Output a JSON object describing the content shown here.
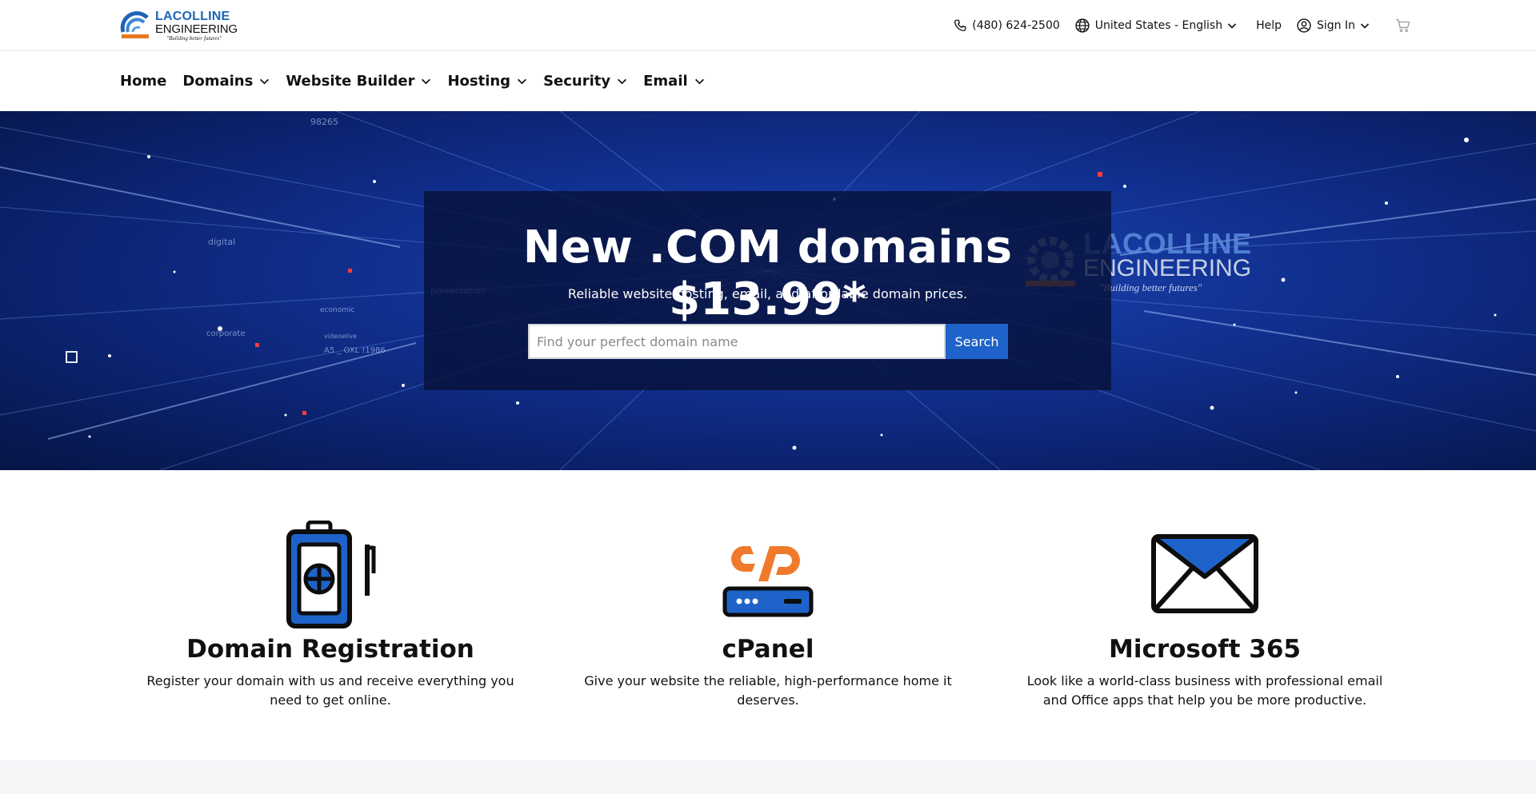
{
  "brand": {
    "line1": "LACOLLINE",
    "line2": "ENGINEERING",
    "tagline": "\"Building better futures\""
  },
  "utility_bar": {
    "phone": "(480) 624-2500",
    "locale": "United States - English",
    "help": "Help",
    "sign_in": "Sign In"
  },
  "nav": {
    "items": [
      {
        "label": "Home",
        "has_menu": false
      },
      {
        "label": "Domains",
        "has_menu": true
      },
      {
        "label": "Website Builder",
        "has_menu": true
      },
      {
        "label": "Hosting",
        "has_menu": true
      },
      {
        "label": "Security",
        "has_menu": true
      },
      {
        "label": "Email",
        "has_menu": true
      }
    ]
  },
  "hero": {
    "title": "New .COM domains $13.99*",
    "subtitle": "Reliable website hosting, email, and affordable domain prices.",
    "search_placeholder": "Find your perfect domain name",
    "search_button": "Search",
    "background_words": [
      "98265",
      "digital",
      "presentation",
      "economic",
      "corporate",
      "videoelive",
      "A5  _ OXL !1986"
    ],
    "watermark": {
      "line1": "LACOLLINE",
      "line2": "ENGINEERING",
      "tagline": "\"Building better futures\""
    }
  },
  "features": [
    {
      "icon": "domain-registration-icon",
      "title": "Domain Registration",
      "description": "Register your domain with us and receive everything you need to get online."
    },
    {
      "icon": "cpanel-icon",
      "title": "cPanel",
      "description": "Give your website the reliable, high-performance home it deserves."
    },
    {
      "icon": "envelope-icon",
      "title": "Microsoft 365",
      "description": "Look like a world-class business with professional email and Office apps that help you be more productive."
    }
  ],
  "colors": {
    "brand_blue": "#1e63b8",
    "button_blue": "#1e63c9",
    "hero_dark": "#0a1f66",
    "cpanel_orange": "#f07a2b"
  }
}
